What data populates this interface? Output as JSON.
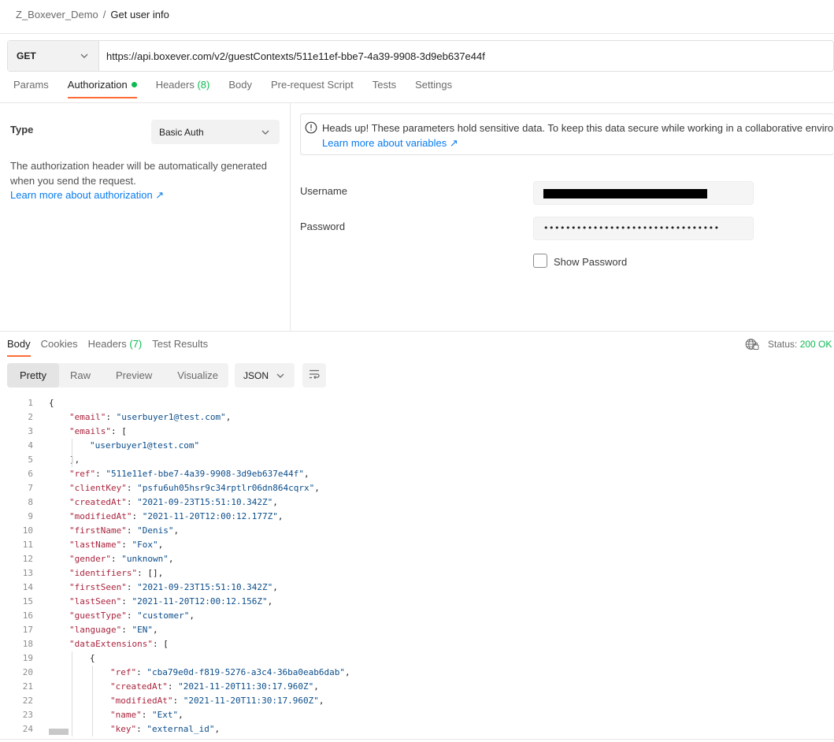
{
  "breadcrumb": {
    "collection": "Z_Boxever_Demo",
    "separator": "/",
    "request": "Get user info"
  },
  "request": {
    "method": "GET",
    "url": "https://api.boxever.com/v2/guestContexts/511e11ef-bbe7-4a39-9908-3d9eb637e44f"
  },
  "request_tabs": [
    {
      "label": "Params",
      "count": ""
    },
    {
      "label": "Authorization",
      "count": ""
    },
    {
      "label": "Headers",
      "count": "(8)"
    },
    {
      "label": "Body",
      "count": ""
    },
    {
      "label": "Pre-request Script",
      "count": ""
    },
    {
      "label": "Tests",
      "count": ""
    },
    {
      "label": "Settings",
      "count": ""
    }
  ],
  "auth": {
    "type_label": "Type",
    "type_value": "Basic Auth",
    "description": "The authorization header will be automatically generated when you send the request.",
    "learn_more": "Learn more about authorization ↗",
    "notice_text": "Heads up! These parameters hold sensitive data. To keep this data secure while working in a collaborative environment,",
    "notice_link": "Learn more about variables ↗",
    "username_label": "Username",
    "password_label": "Password",
    "password_value": "••••••••••••••••••••••••••••••••",
    "show_password_label": "Show Password"
  },
  "response_tabs": [
    {
      "label": "Body",
      "count": ""
    },
    {
      "label": "Cookies",
      "count": ""
    },
    {
      "label": "Headers",
      "count": "(7)"
    },
    {
      "label": "Test Results",
      "count": ""
    }
  ],
  "status": {
    "label": "Status:",
    "value": "200 OK"
  },
  "view_modes": [
    "Pretty",
    "Raw",
    "Preview",
    "Visualize"
  ],
  "format": "JSON",
  "code_lines": [
    {
      "n": "1",
      "indent": 0,
      "text": "{"
    },
    {
      "n": "2",
      "indent": 1,
      "key": "email",
      "val": "\"userbuyer1@test.com\"",
      "end": ","
    },
    {
      "n": "3",
      "indent": 1,
      "key": "emails",
      "val": "[",
      "end": ""
    },
    {
      "n": "4",
      "indent": 2,
      "val": "\"userbuyer1@test.com\"",
      "end": ""
    },
    {
      "n": "5",
      "indent": 1,
      "text": "],"
    },
    {
      "n": "6",
      "indent": 1,
      "key": "ref",
      "val": "\"511e11ef-bbe7-4a39-9908-3d9eb637e44f\"",
      "end": ","
    },
    {
      "n": "7",
      "indent": 1,
      "key": "clientKey",
      "val": "\"psfu6uh05hsr9c34rptlr06dn864cqrx\"",
      "end": ","
    },
    {
      "n": "8",
      "indent": 1,
      "key": "createdAt",
      "val": "\"2021-09-23T15:51:10.342Z\"",
      "end": ","
    },
    {
      "n": "9",
      "indent": 1,
      "key": "modifiedAt",
      "val": "\"2021-11-20T12:00:12.177Z\"",
      "end": ","
    },
    {
      "n": "10",
      "indent": 1,
      "key": "firstName",
      "val": "\"Denis\"",
      "end": ","
    },
    {
      "n": "11",
      "indent": 1,
      "key": "lastName",
      "val": "\"Fox\"",
      "end": ","
    },
    {
      "n": "12",
      "indent": 1,
      "key": "gender",
      "val": "\"unknown\"",
      "end": ","
    },
    {
      "n": "13",
      "indent": 1,
      "key": "identifiers",
      "val": "[]",
      "end": ","
    },
    {
      "n": "14",
      "indent": 1,
      "key": "firstSeen",
      "val": "\"2021-09-23T15:51:10.342Z\"",
      "end": ","
    },
    {
      "n": "15",
      "indent": 1,
      "key": "lastSeen",
      "val": "\"2021-11-20T12:00:12.156Z\"",
      "end": ","
    },
    {
      "n": "16",
      "indent": 1,
      "key": "guestType",
      "val": "\"customer\"",
      "end": ","
    },
    {
      "n": "17",
      "indent": 1,
      "key": "language",
      "val": "\"EN\"",
      "end": ","
    },
    {
      "n": "18",
      "indent": 1,
      "key": "dataExtensions",
      "val": "[",
      "end": ""
    },
    {
      "n": "19",
      "indent": 2,
      "text": "{"
    },
    {
      "n": "20",
      "indent": 3,
      "key": "ref",
      "val": "\"cba79e0d-f819-5276-a3c4-36ba0eab6dab\"",
      "end": ","
    },
    {
      "n": "21",
      "indent": 3,
      "key": "createdAt",
      "val": "\"2021-11-20T11:30:17.960Z\"",
      "end": ","
    },
    {
      "n": "22",
      "indent": 3,
      "key": "modifiedAt",
      "val": "\"2021-11-20T11:30:17.960Z\"",
      "end": ","
    },
    {
      "n": "23",
      "indent": 3,
      "key": "name",
      "val": "\"Ext\"",
      "end": ","
    },
    {
      "n": "24",
      "indent": 3,
      "key": "key",
      "val": "\"external_id\"",
      "end": ","
    }
  ],
  "colors": {
    "accent": "#ff6c37",
    "success": "#0cbb52",
    "link": "#097bed",
    "json_key": "#a9253e",
    "json_string": "#0b4d8a"
  }
}
